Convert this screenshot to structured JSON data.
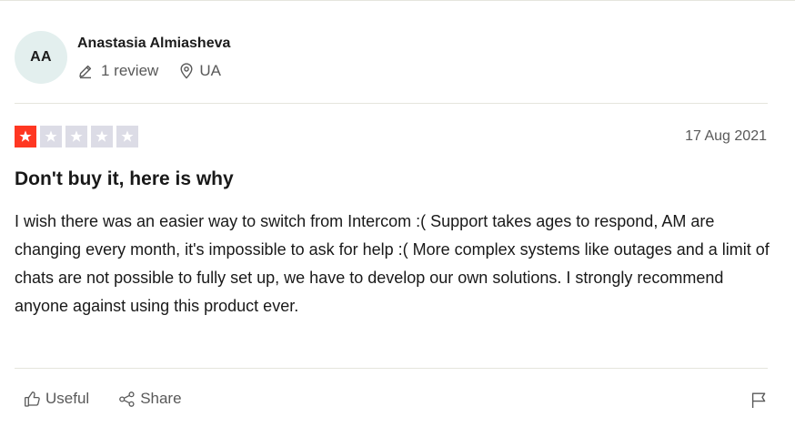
{
  "reviewer": {
    "initials": "AA",
    "name": "Anastasia Almiasheva",
    "review_count": "1 review",
    "country": "UA"
  },
  "review": {
    "rating": 1,
    "max_rating": 5,
    "date": "17 Aug 2021",
    "title": "Don't buy it, here is why",
    "body": "I wish there was an easier way to switch from Intercom :( Support takes ages to respond, AM are changing every month, it's impossible to ask for help :( More complex systems like outages and a limit of chats are not possible to fully set up, we have to develop our own solutions. I strongly recommend anyone against using this product ever."
  },
  "actions": {
    "useful_label": "Useful",
    "share_label": "Share"
  },
  "colors": {
    "star_filled": "#ff3722",
    "star_empty": "#dcdce6",
    "avatar_bg": "#e3efee",
    "muted_text": "#595959"
  },
  "icons": {
    "meta_reviews": "pencil-icon",
    "meta_location": "location-pin-icon",
    "useful": "thumbs-up-icon",
    "share": "share-icon",
    "report": "flag-icon"
  }
}
